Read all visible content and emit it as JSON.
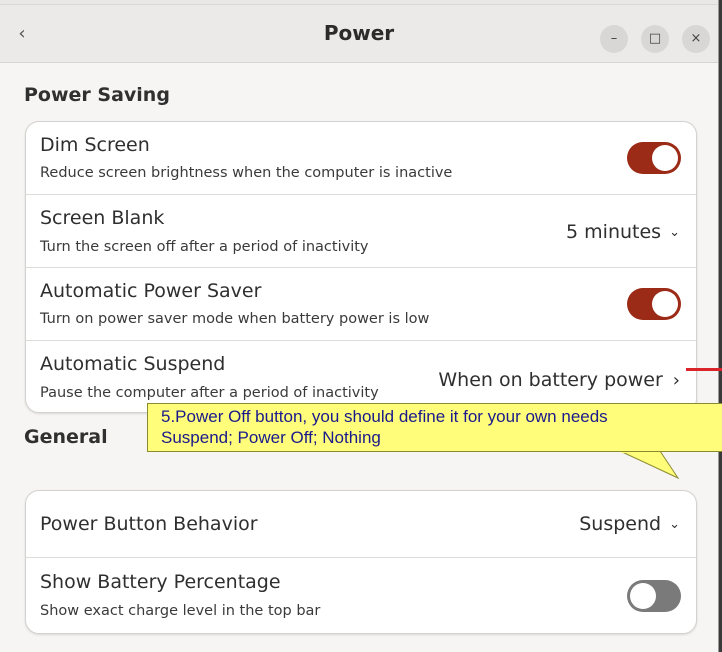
{
  "window": {
    "title": "Power",
    "back_icon": "‹",
    "minimize_icon": "–",
    "maximize_icon": "□",
    "close_icon": "×"
  },
  "power_saving": {
    "heading": "Power Saving",
    "dim_screen": {
      "title": "Dim Screen",
      "subtitle": "Reduce screen brightness when the computer is inactive",
      "enabled": true
    },
    "screen_blank": {
      "title": "Screen Blank",
      "subtitle": "Turn the screen off after a period of inactivity",
      "value": "5 minutes"
    },
    "auto_power_saver": {
      "title": "Automatic Power Saver",
      "subtitle": "Turn on power saver mode when battery power is low",
      "enabled": true
    },
    "auto_suspend": {
      "title": "Automatic Suspend",
      "subtitle": "Pause the computer after a period of inactivity",
      "value": "When on battery power"
    }
  },
  "general": {
    "heading": "General",
    "power_button": {
      "title": "Power Button Behavior",
      "value": "Suspend"
    },
    "battery_percentage": {
      "title": "Show Battery Percentage",
      "subtitle": "Show exact charge level in the top bar",
      "enabled": false
    }
  },
  "annotation": {
    "line1": "5.Power Off button, you should define it for your own needs",
    "line2": "Suspend; Power Off; Nothing"
  },
  "colors": {
    "toggle_on": "#9b2a16",
    "toggle_off": "#7a7a7a",
    "callout_bg": "#fffd7a",
    "callout_text": "#1a1a8c",
    "arrow_line": "#d9242a"
  }
}
